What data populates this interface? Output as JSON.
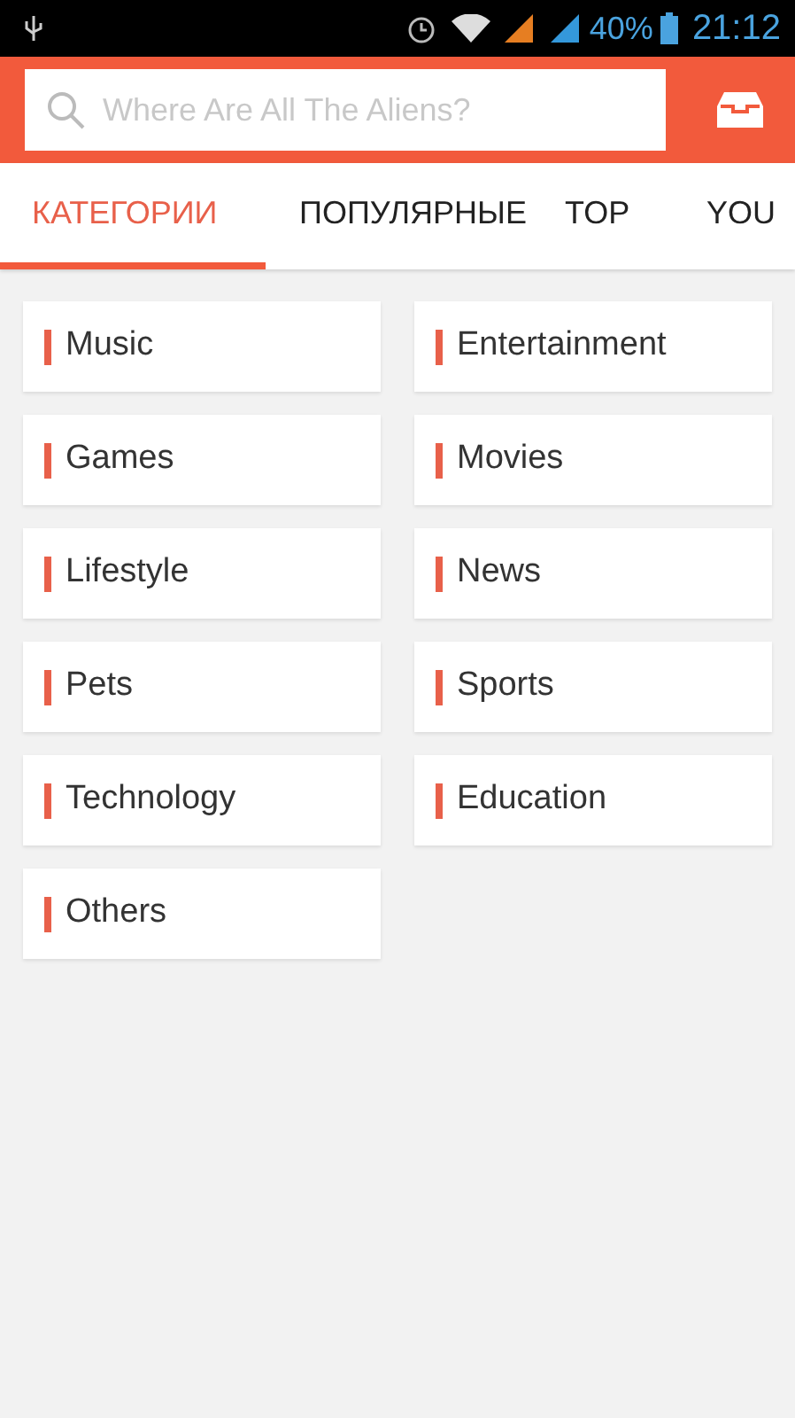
{
  "status_bar": {
    "battery_percent": "40%",
    "time": "21:12"
  },
  "search": {
    "placeholder": "Where Are All The Aliens?"
  },
  "tabs": [
    {
      "label": "КАТЕГОРИИ",
      "selected": true
    },
    {
      "label": "ПОПУЛЯРНЫЕ",
      "selected": false
    },
    {
      "label": "TOP",
      "selected": false
    },
    {
      "label": "YOU",
      "selected": false
    }
  ],
  "categories": [
    "Music",
    "Entertainment",
    "Games",
    "Movies",
    "Lifestyle",
    "News",
    "Pets",
    "Sports",
    "Technology",
    "Education",
    "Others"
  ]
}
